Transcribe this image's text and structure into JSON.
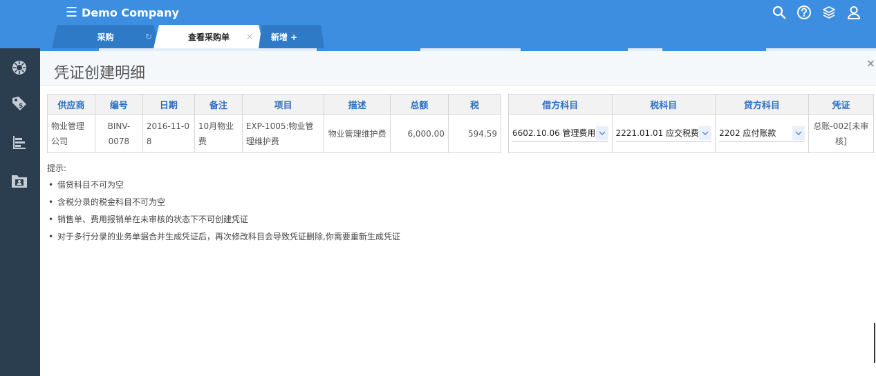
{
  "app": {
    "brand": "Demo Company"
  },
  "tabs": [
    {
      "label": "采购"
    },
    {
      "label": "查看采购单"
    },
    {
      "label": "新增 +"
    }
  ],
  "dialog": {
    "title": "凭证创建明细",
    "close": "×"
  },
  "left_table": {
    "headers": [
      "供应商",
      "编号",
      "日期",
      "备注",
      "项目",
      "描述",
      "总额",
      "税"
    ],
    "row": {
      "supplier": "物业管理公司",
      "number": "BINV-0078",
      "date": "2016-11-08",
      "remark": "10月物业费",
      "item": "EXP-1005:物业管理维护费",
      "description": "物业管理维护费",
      "total": "6,000.00",
      "tax": "594.59"
    }
  },
  "right_table": {
    "headers": [
      "借方科目",
      "税科目",
      "贷方科目",
      "凭证"
    ],
    "debit": "6602.10.06 管理费用",
    "tax_account": "2221.01.01 应交税费",
    "credit": "2202 应付账款",
    "voucher": "总账-002[未审核]"
  },
  "tips": {
    "heading": "提示:",
    "items": [
      "借贷科目不可为空",
      "含税分录的税金科目不可为空",
      "销售单、费用报销单在未审核的状态下不可创建凭证",
      "对于多行分录的业务单据合并生成凭证后，再次修改科目会导致凭证删除,你需要重新生成凭证"
    ]
  },
  "colors": {
    "topbar": "#3d8ee0",
    "sidebar": "#2b3e50",
    "header_text": "#2c6fc4"
  }
}
